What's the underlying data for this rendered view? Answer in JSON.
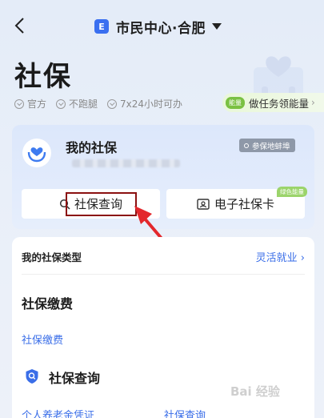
{
  "header": {
    "city_badge": "E",
    "city": "市民中心·合肥"
  },
  "page": {
    "title": "社保",
    "features": [
      "官方",
      "不跑腿",
      "7x24小时可办"
    ],
    "energy_pill": "能量",
    "energy_label": "做任务领能量",
    "energy_arrow": "›"
  },
  "card": {
    "title": "我的社保",
    "location_tag": "参保地蚌埠",
    "buttons": [
      {
        "label": "社保查询",
        "icon": "search-icon"
      },
      {
        "label": "电子社保卡",
        "icon": "id-card-icon"
      }
    ],
    "green_tag": "绿色能量"
  },
  "panel": {
    "type_label": "我的社保类型",
    "type_value": "灵活就业 ›",
    "payment_title": "社保缴费",
    "payment_link": "社保缴费",
    "query_title": "社保查询",
    "links": [
      "个人养老金凭证",
      "社保查询"
    ]
  },
  "watermark": "Bai 经验",
  "colors": {
    "accent_blue": "#3a6ee8",
    "highlight": "#8b1111",
    "arrow": "#e3282d",
    "energy_green": "#7ac142"
  }
}
